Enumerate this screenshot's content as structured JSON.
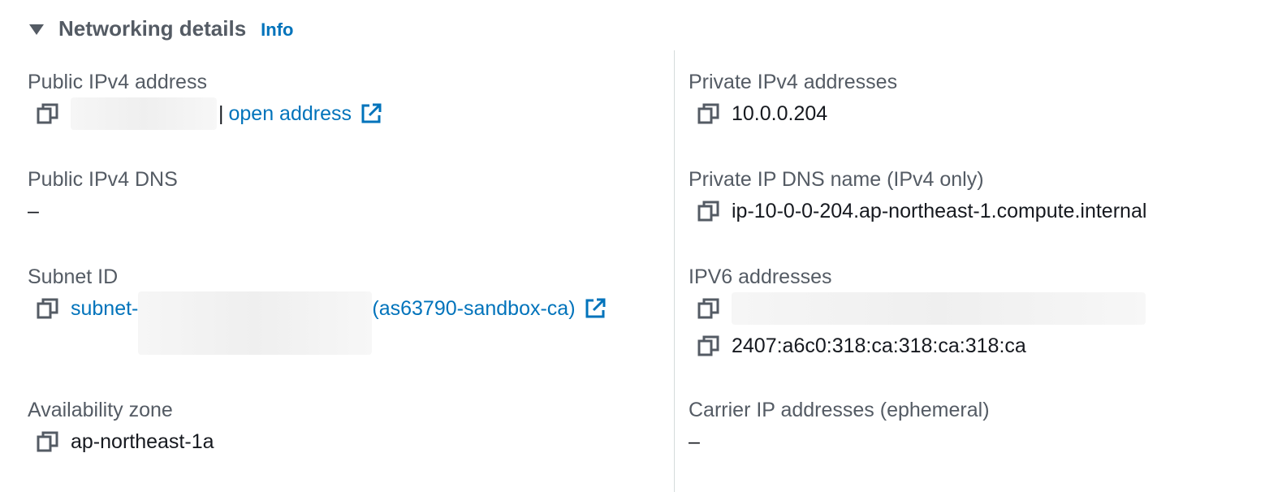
{
  "header": {
    "title": "Networking details",
    "info_label": "Info"
  },
  "left": {
    "public_ipv4": {
      "label": "Public IPv4 address",
      "link_text": "open address"
    },
    "public_dns": {
      "label": "Public IPv4 DNS",
      "value": "–"
    },
    "subnet": {
      "label": "Subnet ID",
      "prefix": "subnet-",
      "suffix": "(as63790-sandbox-ca)"
    },
    "az": {
      "label": "Availability zone",
      "value": "ap-northeast-1a"
    }
  },
  "right": {
    "private_ipv4": {
      "label": "Private IPv4 addresses",
      "value": "10.0.0.204"
    },
    "private_dns": {
      "label": "Private IP DNS name (IPv4 only)",
      "value": "ip-10-0-0-204.ap-northeast-1.compute.internal"
    },
    "ipv6": {
      "label": "IPV6 addresses",
      "value2": "2407:a6c0:318:ca:318:ca:318:ca"
    },
    "carrier": {
      "label": "Carrier IP addresses (ephemeral)",
      "value": "–"
    }
  },
  "icons": {
    "copy": "copy-icon",
    "external": "external-link-icon",
    "caret": "caret-down-icon"
  },
  "colors": {
    "link": "#0073bb",
    "label": "#545b64",
    "text": "#16191f",
    "divider": "#d5dbdb"
  }
}
